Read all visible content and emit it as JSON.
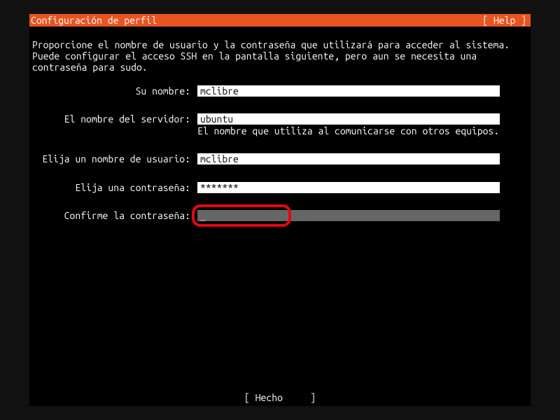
{
  "header": {
    "title": "Configuración de perfil",
    "help": "[ Help ]"
  },
  "intro": "Proporcione el nombre de usuario y la contraseña que utilizará para acceder al sistema. Puede configurar el acceso SSH en la pantalla siguiente, pero aun se necesita una contraseña para sudo.",
  "fields": {
    "name_label": "Su nombre:",
    "name_value": "mclibre",
    "server_label": "El nombre del servidor:",
    "server_value": "ubuntu",
    "server_hint": "El nombre que utiliza al comunicarse con otros equipos.",
    "user_label": "Elija un nombre de usuario:",
    "user_value": "mclibre",
    "pass_label": "Elija una contraseña:",
    "pass_value": "*******",
    "confirm_label": "Confirme la contraseña:",
    "confirm_value": "_"
  },
  "footer": "[ Hecho     ]"
}
